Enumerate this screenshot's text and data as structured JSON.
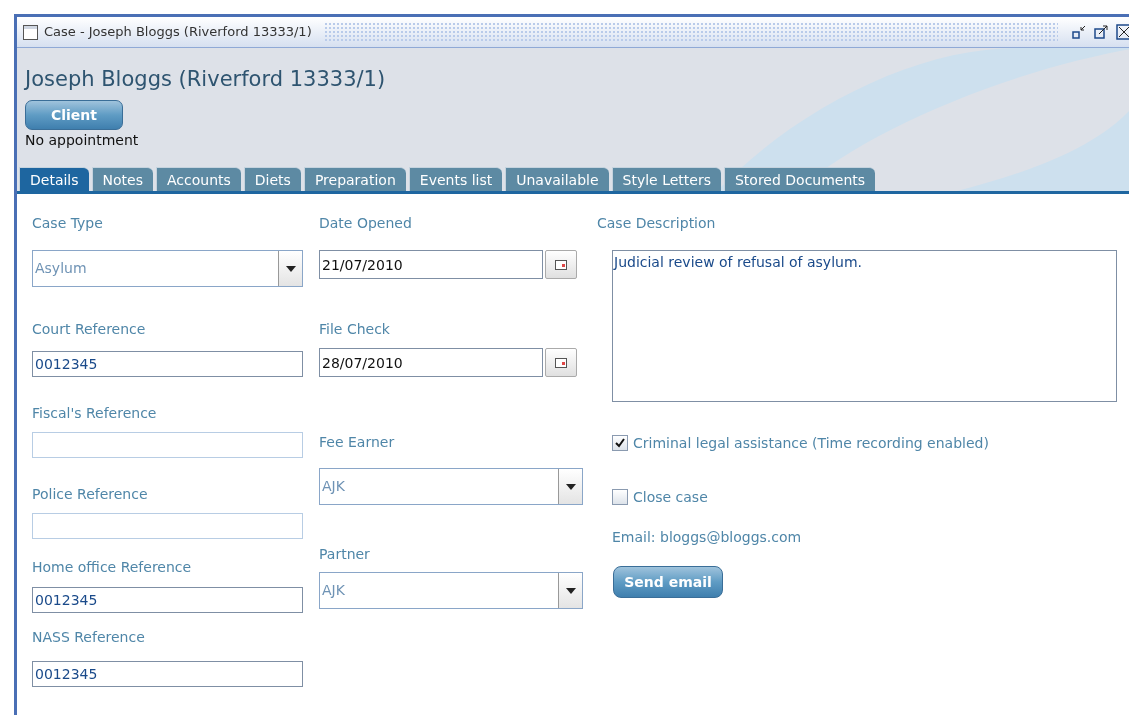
{
  "window": {
    "title": "Case - Joseph Bloggs (Riverford 13333/1)"
  },
  "header": {
    "name": "Joseph Bloggs (Riverford 13333/1)",
    "client_button": "Client",
    "appointment": "No appointment"
  },
  "tabs": [
    {
      "label": "Details",
      "selected": true
    },
    {
      "label": "Notes",
      "selected": false
    },
    {
      "label": "Accounts",
      "selected": false
    },
    {
      "label": "Diets",
      "selected": false
    },
    {
      "label": "Preparation",
      "selected": false
    },
    {
      "label": "Events list",
      "selected": false
    },
    {
      "label": "Unavailable",
      "selected": false
    },
    {
      "label": "Style Letters",
      "selected": false
    },
    {
      "label": "Stored Documents",
      "selected": false
    }
  ],
  "left_fields": [
    {
      "label": "Case Type",
      "value": "Asylum",
      "kind": "select"
    },
    {
      "label": "Court Reference",
      "value": "0012345",
      "kind": "text"
    },
    {
      "label": "Fiscal's Reference",
      "kind": "text"
    },
    {
      "label": "Police Reference",
      "kind": "text"
    },
    {
      "label": "Home office Reference",
      "value": "0012345",
      "kind": "text"
    },
    {
      "label": "NASS Reference",
      "value": "0012345",
      "kind": "text"
    }
  ],
  "middle_fields": [
    {
      "label": "Date Opened",
      "value": "21/07/2010",
      "kind": "date"
    },
    {
      "label": "File Check",
      "value": "28/07/2010",
      "kind": "date"
    },
    {
      "label": "Fee Earner",
      "value": "AJK",
      "kind": "select"
    },
    {
      "label": "Partner",
      "value": "AJK",
      "kind": "select"
    }
  ],
  "description": {
    "label": "Case Description",
    "value": "Judicial review of refusal of asylum."
  },
  "checkboxes": [
    {
      "label": "Criminal legal assistance (Time recording enabled)",
      "checked": true
    },
    {
      "label": "Close case",
      "checked": false
    }
  ],
  "email": "Email: bloggs@bloggs.com",
  "send_button": "Send email"
}
